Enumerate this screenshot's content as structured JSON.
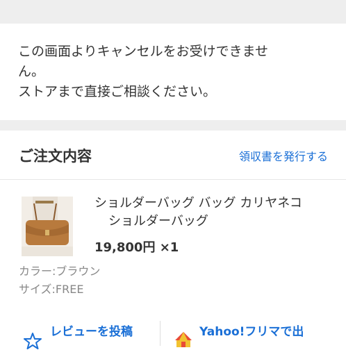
{
  "notice": {
    "line1": "この画面よりキャンセルをお受けできませ",
    "line2": "ん。",
    "line3": "ストアまで直接ご相談ください。"
  },
  "order": {
    "title": "ご注文内容",
    "receipt_link": "領収書を発行する"
  },
  "item": {
    "name_line1": "ショルダーバッグ バッグ カリヤネコ",
    "name_line2": "ショルダーバッグ",
    "price": "19,800円 ×1",
    "color": "カラー:ブラウン",
    "size": "サイズ:FREE"
  },
  "actions": {
    "review": "レビューを投稿",
    "flea": "Yahoo!フリマで出"
  },
  "colors": {
    "link": "#1a6fd6",
    "divider_band": "#eeeeee",
    "bag_brown": "#b87a3d"
  },
  "icons": {
    "review": "star-outline-icon",
    "flea": "flea-market-tent-icon"
  }
}
